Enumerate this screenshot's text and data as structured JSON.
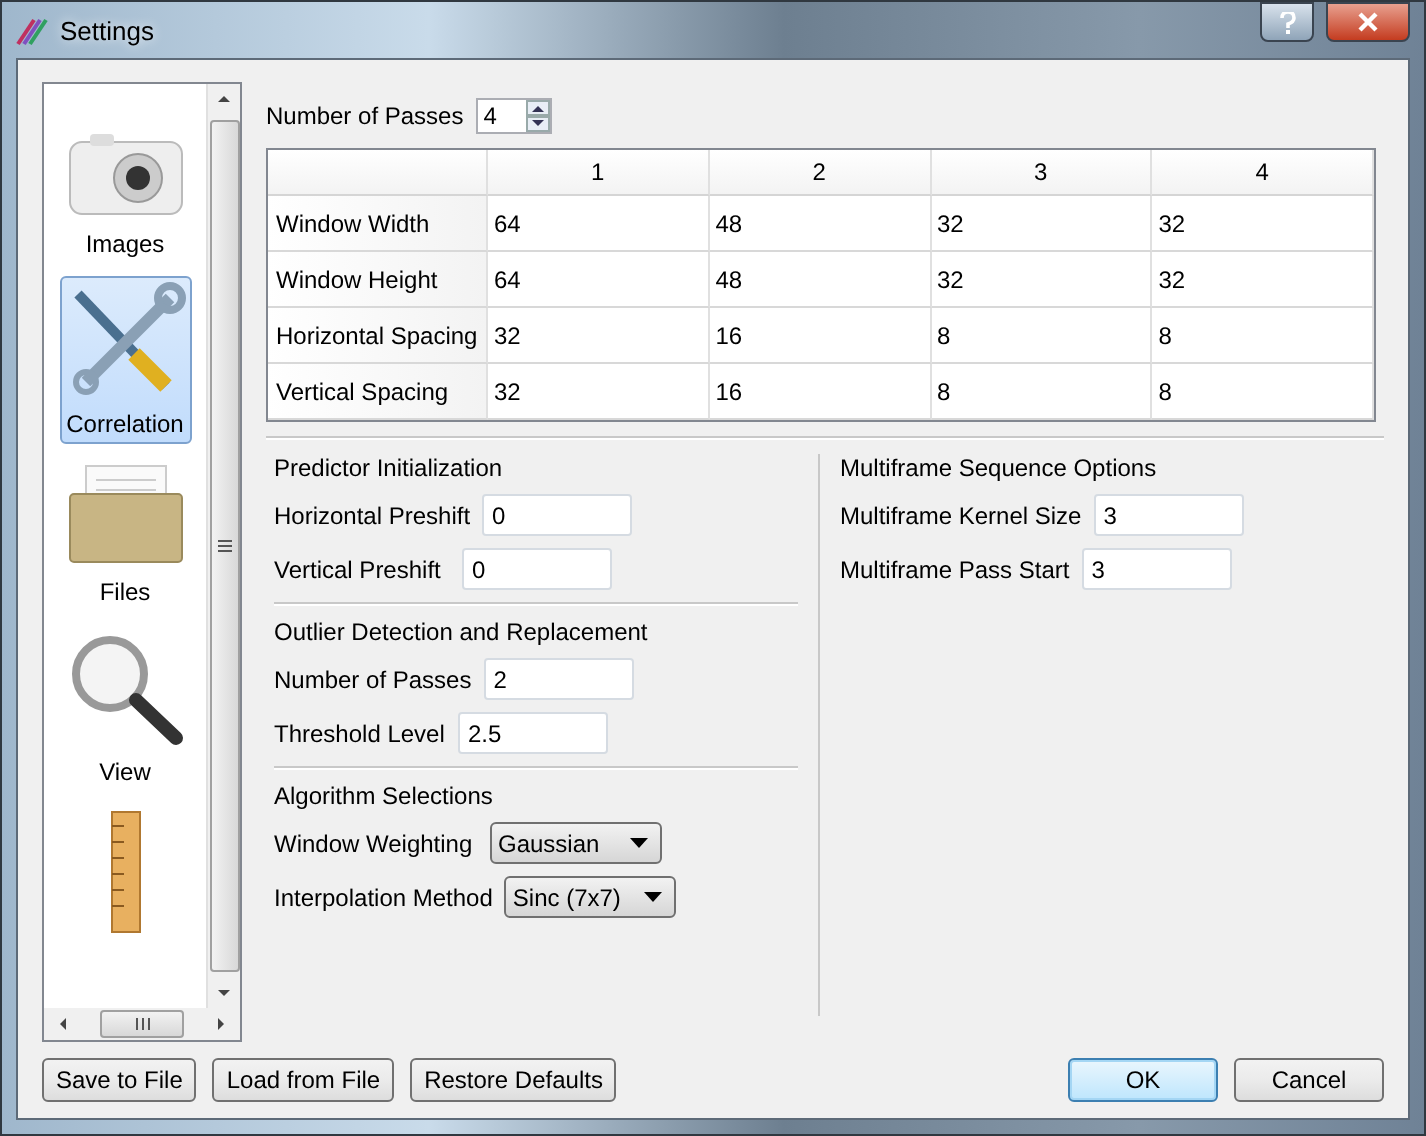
{
  "window": {
    "title": "Settings"
  },
  "sidebar": {
    "items": [
      {
        "kind": "camera",
        "label": "Images",
        "selected": false
      },
      {
        "kind": "tools",
        "label": "Correlation",
        "selected": true
      },
      {
        "kind": "folder",
        "label": "Files",
        "selected": false
      },
      {
        "kind": "magnifier",
        "label": "View",
        "selected": false
      },
      {
        "kind": "ruler",
        "selected": false
      }
    ]
  },
  "passes": {
    "label": "Number of Passes",
    "value": "4"
  },
  "table": {
    "columns": [
      "1",
      "2",
      "3",
      "4"
    ],
    "rows": [
      {
        "label": "Window Width",
        "cells": [
          "64",
          "48",
          "32",
          "32"
        ]
      },
      {
        "label": "Window Height",
        "cells": [
          "64",
          "48",
          "32",
          "32"
        ]
      },
      {
        "label": "Horizontal Spacing",
        "cells": [
          "32",
          "16",
          "8",
          "8"
        ]
      },
      {
        "label": "Vertical Spacing",
        "cells": [
          "32",
          "16",
          "8",
          "8"
        ]
      }
    ]
  },
  "predictor": {
    "title": "Predictor Initialization",
    "fields": [
      {
        "label": "Horizontal Preshift",
        "value": "0"
      },
      {
        "label": "Vertical Preshift",
        "value": "0"
      }
    ]
  },
  "outlier": {
    "title": "Outlier Detection and Replacement",
    "fields": [
      {
        "label": "Number of Passes",
        "value": "2"
      },
      {
        "label": "Threshold Level",
        "value": "2.5"
      }
    ]
  },
  "algorithm": {
    "title": "Algorithm Selections",
    "selects": [
      {
        "label": "Window Weighting",
        "value": "Gaussian"
      },
      {
        "label": "Interpolation Method",
        "value": "Sinc (7x7)"
      }
    ]
  },
  "multiframe": {
    "title": "Multiframe Sequence Options",
    "fields": [
      {
        "label": "Multiframe Kernel Size",
        "value": "3"
      },
      {
        "label": "Multiframe Pass Start",
        "value": "3"
      }
    ]
  },
  "buttons_left": [
    "Save to File",
    "Load from File",
    "Restore Defaults"
  ],
  "buttons_right": [
    {
      "label": "OK",
      "default": true
    },
    {
      "label": "Cancel",
      "default": false
    }
  ]
}
